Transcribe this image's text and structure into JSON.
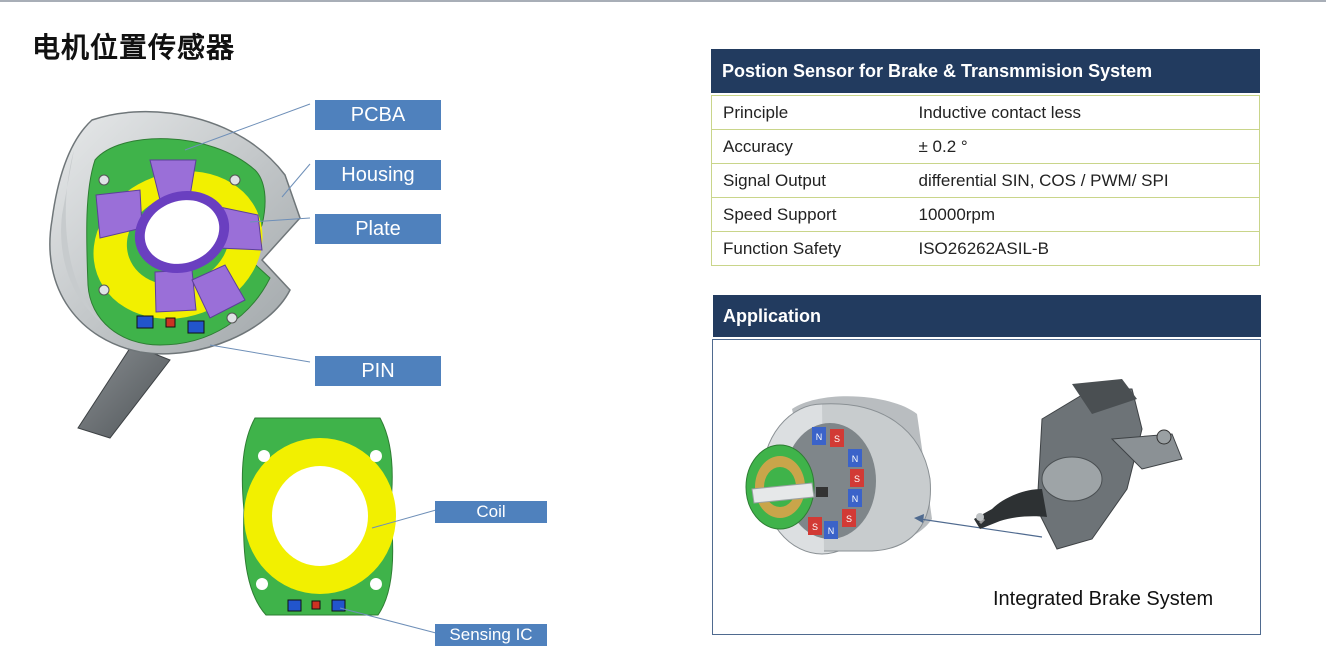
{
  "title": "电机位置传感器",
  "labels": {
    "pcba": "PCBA",
    "housing": "Housing",
    "plate": "Plate",
    "pin": "PIN",
    "coil": "Coil",
    "sensing_ic": "Sensing IC"
  },
  "spec": {
    "header": "Postion Sensor for Brake & Transmmision System",
    "rows": [
      {
        "key": "Principle",
        "value": "Inductive contact less"
      },
      {
        "key": "Accuracy",
        "value": "± 0.2 °"
      },
      {
        "key": "Signal Output",
        "value": "differential SIN, COS / PWM/ SPI"
      },
      {
        "key": "Speed Support",
        "value": "10000rpm"
      },
      {
        "key": "Function Safety",
        "value": "ISO26262ASIL-B"
      }
    ]
  },
  "application": {
    "header": "Application",
    "caption": "Integrated Brake System",
    "magnet_letters": [
      "N",
      "S",
      "N",
      "S",
      "N",
      "S",
      "N",
      "S"
    ]
  },
  "colors": {
    "callout": "#4f81bd",
    "header_navy": "#223b5f",
    "pcb_green": "#3fb34a",
    "coil_yellow": "#f2f000",
    "plate_purple": "#9a6fd8",
    "table_border": "#c9d58a"
  }
}
